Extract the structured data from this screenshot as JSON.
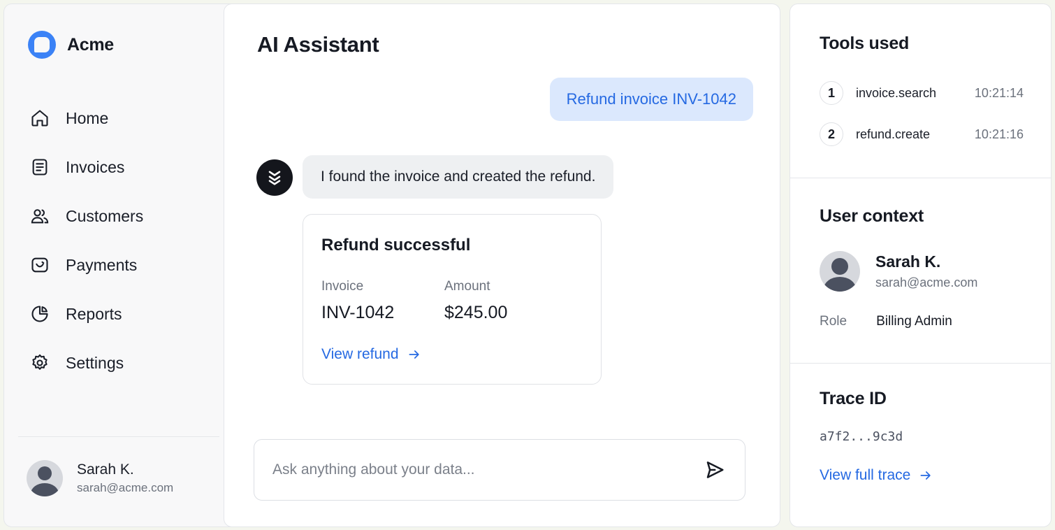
{
  "brand": {
    "name": "Acme",
    "logo_icon": "chat-bubble-logo-icon",
    "accent": "#3b82f6"
  },
  "sidebar": {
    "items": [
      {
        "label": "Home",
        "icon": "home-icon"
      },
      {
        "label": "Invoices",
        "icon": "invoice-icon"
      },
      {
        "label": "Customers",
        "icon": "users-icon"
      },
      {
        "label": "Payments",
        "icon": "wallet-icon"
      },
      {
        "label": "Reports",
        "icon": "pie-chart-icon"
      },
      {
        "label": "Settings",
        "icon": "gear-icon"
      }
    ],
    "user": {
      "name": "Sarah K.",
      "email": "sarah@acme.com"
    }
  },
  "main": {
    "title": "AI Assistant",
    "messages": {
      "user": "Refund invoice INV-1042",
      "assistant": "I found the invoice and created the refund."
    },
    "card": {
      "title": "Refund successful",
      "invoice_label": "Invoice",
      "invoice_value": "INV-1042",
      "amount_label": "Amount",
      "amount_value": "$245.00",
      "link": "View refund"
    },
    "composer": {
      "placeholder": "Ask anything about your data...",
      "send_icon": "send-icon"
    }
  },
  "right": {
    "tools": {
      "title": "Tools used",
      "items": [
        {
          "num": "1",
          "name": "invoice.search",
          "time": "10:21:14"
        },
        {
          "num": "2",
          "name": "refund.create",
          "time": "10:21:16"
        }
      ]
    },
    "context": {
      "title": "User context",
      "name": "Sarah K.",
      "email": "sarah@acme.com",
      "role_label": "Role",
      "role_value": "Billing Admin"
    },
    "trace": {
      "title": "Trace ID",
      "value": "a7f2...9c3d",
      "link": "View full trace"
    }
  },
  "colors": {
    "link": "#2569e2",
    "user_bubble": "#dbe8fd",
    "assistant_bubble": "#eef0f2"
  }
}
